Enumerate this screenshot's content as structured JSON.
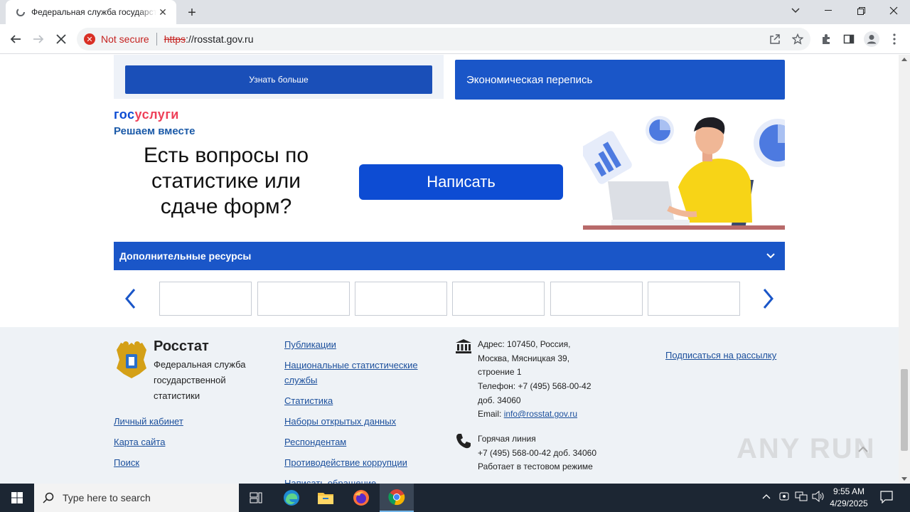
{
  "browser": {
    "tab_title": "Федеральная служба государственной статистики",
    "security_label": "Not secure",
    "url_scheme": "https",
    "url_rest": "://rosstat.gov.ru"
  },
  "page": {
    "learn_more": "Узнать больше",
    "census_label": "Экономическая перепись",
    "gos_logo_part1": "гос",
    "gos_logo_part2": "услуги",
    "gos_tagline": "Решаем вместе",
    "question_text": "Есть вопросы по статистике или сдаче форм?",
    "write_button": "Написать",
    "resources_label": "Дополнительные ресурсы"
  },
  "footer": {
    "brand": "Росстат",
    "brand_sub": "Федеральная служба государственной статистики",
    "left_links": [
      "Личный кабинет",
      "Карта сайта",
      "Поиск"
    ],
    "mid_links": [
      "Публикации",
      "Национальные статистические службы",
      "Статистика",
      "Наборы открытых данных",
      "Респондентам",
      "Противодействие коррупции",
      "Написать обращение"
    ],
    "address_label": "Адрес:",
    "address_value": "107450, Россия, Москва, Мясницкая 39, строение 1",
    "phone_line": "Телефон: +7 (495) 568-00-42 доб. 34060",
    "email_label": "Email:",
    "email_value": "info@rosstat.gov.ru",
    "hotline_title": "Горячая линия",
    "hotline_phone": "+7 (495) 568-00-42 доб. 34060",
    "hotline_note": "Работает в тестовом режиме",
    "subscribe": "Подписаться на рассылку"
  },
  "watermark": "ANY RUN",
  "taskbar": {
    "search_placeholder": "Type here to search",
    "time": "9:55 AM",
    "date": "4/29/2025"
  },
  "colors": {
    "accent_blue": "#1a56c8",
    "gos_blue": "#0d4cd3",
    "gos_red": "#ee3f58",
    "insecure_red": "#d93025"
  }
}
